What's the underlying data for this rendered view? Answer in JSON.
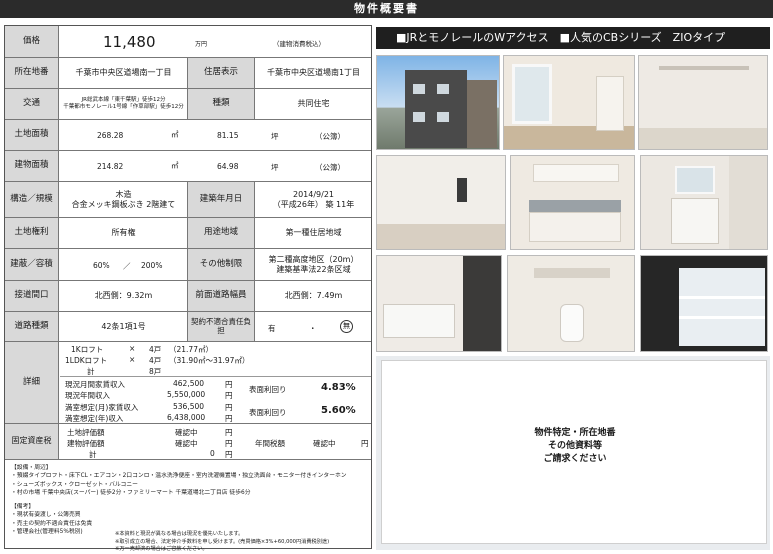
{
  "banner": {
    "title": "物件概要書"
  },
  "spec": {
    "price": {
      "label": "価格",
      "value": "11,480",
      "unit": "万円",
      "note": "（建物消費税込）"
    },
    "location": {
      "label": "所在地番",
      "value": "千葉市中央区道場南一丁目",
      "label2": "住居表示",
      "value2": "千葉市中央区道場南1丁目"
    },
    "transport": {
      "label": "交通",
      "line1": "JR総武本線「東千葉駅」徒歩12分",
      "line2": "千葉都市モノレール1号線「作草部駅」徒歩12分",
      "label2": "種類",
      "value2": "共同住宅"
    },
    "land_area": {
      "label": "土地面積",
      "sqm": "268.28",
      "sqm_unit": "㎡",
      "tsubo": "81.15",
      "tsubo_unit": "坪",
      "note": "（公簿）"
    },
    "building_area": {
      "label": "建物面積",
      "sqm": "214.82",
      "sqm_unit": "㎡",
      "tsubo": "64.98",
      "tsubo_unit": "坪",
      "note": "（公簿）"
    },
    "structure": {
      "label": "構造／規模",
      "line1": "木造",
      "line2": "合金メッキ鋼板ぶき 2階建て",
      "label2": "建築年月日",
      "date": "2014/9/21",
      "age": "（平成26年） 築 11年"
    },
    "rights": {
      "label": "土地権利",
      "value": "所有権",
      "label2": "用途地域",
      "value2": "第一種住居地域"
    },
    "coverage": {
      "label": "建蔽／容積",
      "bcr": "60%",
      "sep": "／",
      "far": "200%",
      "label2": "その他制限",
      "line1": "第二種高度地区（20m）",
      "line2": "建築基準法22条区域"
    },
    "frontage": {
      "label": "接道間口",
      "value": "北西側：9.32m",
      "label2": "前面道路幅員",
      "value2": "北西側：7.49m"
    },
    "road_type": {
      "label": "道路種類",
      "value": "42条1項1号",
      "label2": "契約不適合責任負担",
      "yes": "有",
      "dot": "・",
      "no": "無"
    },
    "details": {
      "label": "詳細",
      "units": [
        {
          "type": "1Kロフト",
          "x": "×",
          "count": "4戸",
          "area": "（21.77㎡）"
        },
        {
          "type": "1LDKロフト",
          "x": "×",
          "count": "4戸",
          "area": "（31.90㎡～31.97㎡）"
        },
        {
          "type": "計",
          "x": "",
          "count": "8戸",
          "area": ""
        }
      ],
      "income": [
        {
          "name": "現況月間家賃収入",
          "value": "462,500",
          "unit": "円"
        },
        {
          "name": "現況年間収入",
          "value": "5,550,000",
          "unit": "円"
        },
        {
          "name": "満室想定(月)家賃収入",
          "value": "536,500",
          "unit": "円"
        },
        {
          "name": "満室想定(年)収入",
          "value": "6,438,000",
          "unit": "円"
        }
      ],
      "yield_current_label": "表面利回り",
      "yield_current": "4.83%",
      "yield_full_label": "表面利回り",
      "yield_full": "5.60%"
    },
    "tax": {
      "label": "固定資産税",
      "land": {
        "name": "土地評価額",
        "value": "確認中",
        "unit": "円"
      },
      "building": {
        "name": "建物評価額",
        "value": "確認中",
        "unit": "円"
      },
      "total": {
        "name": "計",
        "value": "0",
        "unit": "円"
      },
      "annual_label": "年間税額",
      "annual_value": "確認中",
      "annual_unit": "円"
    },
    "facilities": {
      "heading": "【設備・周辺】",
      "lines": [
        "・預綴タイプロフト・床下CL・エアコン・2口コンロ・温水洗浄便座・室内洗濯機置場・独立洗面台・モニター付きインターホン",
        "・シューズボックス・クローゼット・バルコニー",
        "・村の市場 千葉中央店(スーパー) 徒歩2分・ファミリーマート 千葉道場北二丁目店 徒歩6分"
      ]
    },
    "remarks": {
      "heading": "【備考】",
      "lines": [
        "・現状有姿渡し・公簿売買",
        "・売主の契約不適合責任は免責",
        "・管理会社(管理料5%税別)"
      ]
    },
    "footer_notes": [
      "※本資料と現況が異なる場合は現況を優先いたします。",
      "※取引成立の場合、法定仲介手数料を申し受けます。(売買価格×3%+60,000円消費税別途)",
      "※万一売却済の場合はご容赦ください。"
    ]
  },
  "ad": {
    "tagline": "■JRとモノレールのWアクセス　■人気のCBシリーズ　ZIOタイプ",
    "overlay_lines": [
      "物件特定・所在地番",
      "その他資料等",
      "ご請求ください"
    ]
  }
}
